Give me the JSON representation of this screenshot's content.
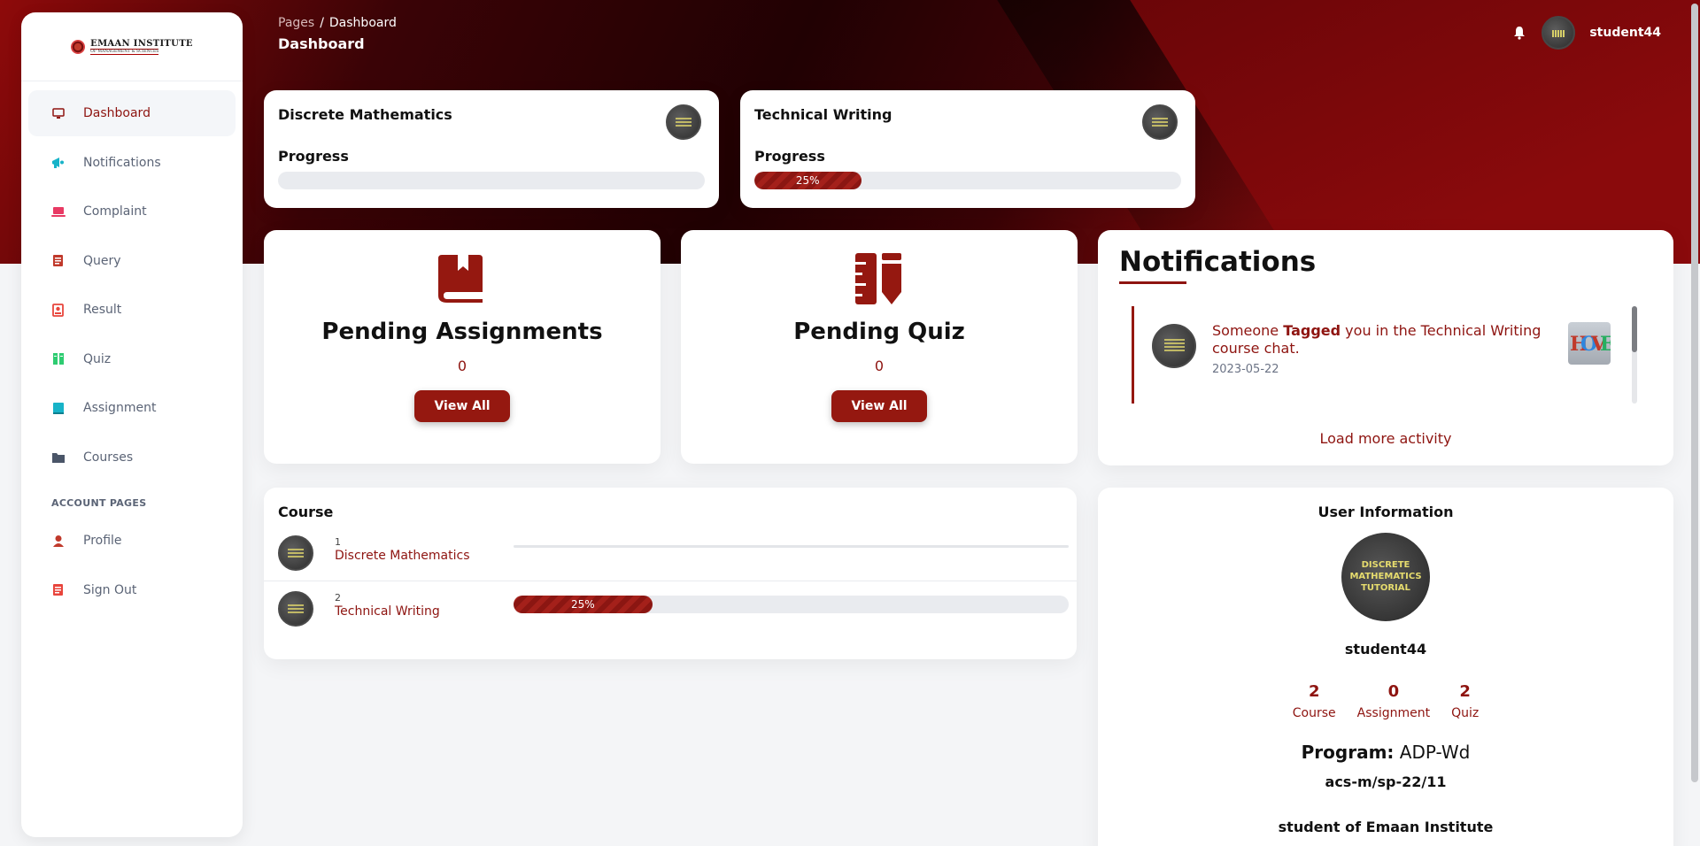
{
  "brand": {
    "logo_title": "EMAAN INSTITUTE",
    "logo_subtitle": "OF MANAGEMENT & SCIENCES"
  },
  "sidebar": {
    "items": [
      {
        "label": "Dashboard",
        "icon": "monitor-icon",
        "color": "#8e1410"
      },
      {
        "label": "Notifications",
        "icon": "megaphone-icon",
        "color": "#17b3c8"
      },
      {
        "label": "Complaint",
        "icon": "laptop-icon",
        "color": "#e83a64"
      },
      {
        "label": "Query",
        "icon": "document-icon",
        "color": "#c0392b"
      },
      {
        "label": "Result",
        "icon": "user-card-icon",
        "color": "#e8453c"
      },
      {
        "label": "Quiz",
        "icon": "books-icon",
        "color": "#2ecc71"
      },
      {
        "label": "Assignment",
        "icon": "book-icon",
        "color": "#17b3c8"
      },
      {
        "label": "Courses",
        "icon": "folder-icon",
        "color": "#4a5568"
      }
    ],
    "section_title": "ACCOUNT PAGES",
    "account_items": [
      {
        "label": "Profile",
        "icon": "person-icon",
        "color": "#c0392b"
      },
      {
        "label": "Sign Out",
        "icon": "document-icon",
        "color": "#e8453c"
      }
    ]
  },
  "header": {
    "breadcrumb_root": "Pages",
    "breadcrumb_sep": "/",
    "breadcrumb_current": "Dashboard",
    "title": "Dashboard",
    "username": "student44"
  },
  "course_cards": [
    {
      "title": "Discrete Mathematics",
      "progress_label": "Progress",
      "progress": 0,
      "progress_text": ""
    },
    {
      "title": "Technical Writing",
      "progress_label": "Progress",
      "progress": 25,
      "progress_text": "25%"
    }
  ],
  "stats": {
    "assignments": {
      "title": "Pending Assignments",
      "count": "0",
      "button": "View All"
    },
    "quiz": {
      "title": "Pending Quiz",
      "count": "0",
      "button": "View All"
    }
  },
  "notifications": {
    "title": "Notifications",
    "item": {
      "prefix": "Someone ",
      "bold": "Tagged",
      "suffix": " you in the Technical Writing course chat.",
      "date": "2023-05-22"
    },
    "load_more": "Load more activity"
  },
  "course_list": {
    "title": "Course",
    "rows": [
      {
        "num": "1",
        "name": "Discrete Mathematics",
        "progress": 0,
        "progress_text": ""
      },
      {
        "num": "2",
        "name": "Technical Writing",
        "progress": 25,
        "progress_text": "25%"
      }
    ]
  },
  "user_info": {
    "title": "User Information",
    "avatar_text": "DISCRETE MATHEMATICS TUTORIAL",
    "name": "student44",
    "stats": [
      {
        "value": "2",
        "label": "Course"
      },
      {
        "value": "0",
        "label": "Assignment"
      },
      {
        "value": "2",
        "label": "Quiz"
      }
    ],
    "program_label": "Program:",
    "program_value": "ADP-Wd",
    "reg_id": "acs-m/sp-22/11",
    "org": "student of Emaan Institute"
  },
  "colors": {
    "accent": "#8e1410",
    "button": "#951810"
  }
}
